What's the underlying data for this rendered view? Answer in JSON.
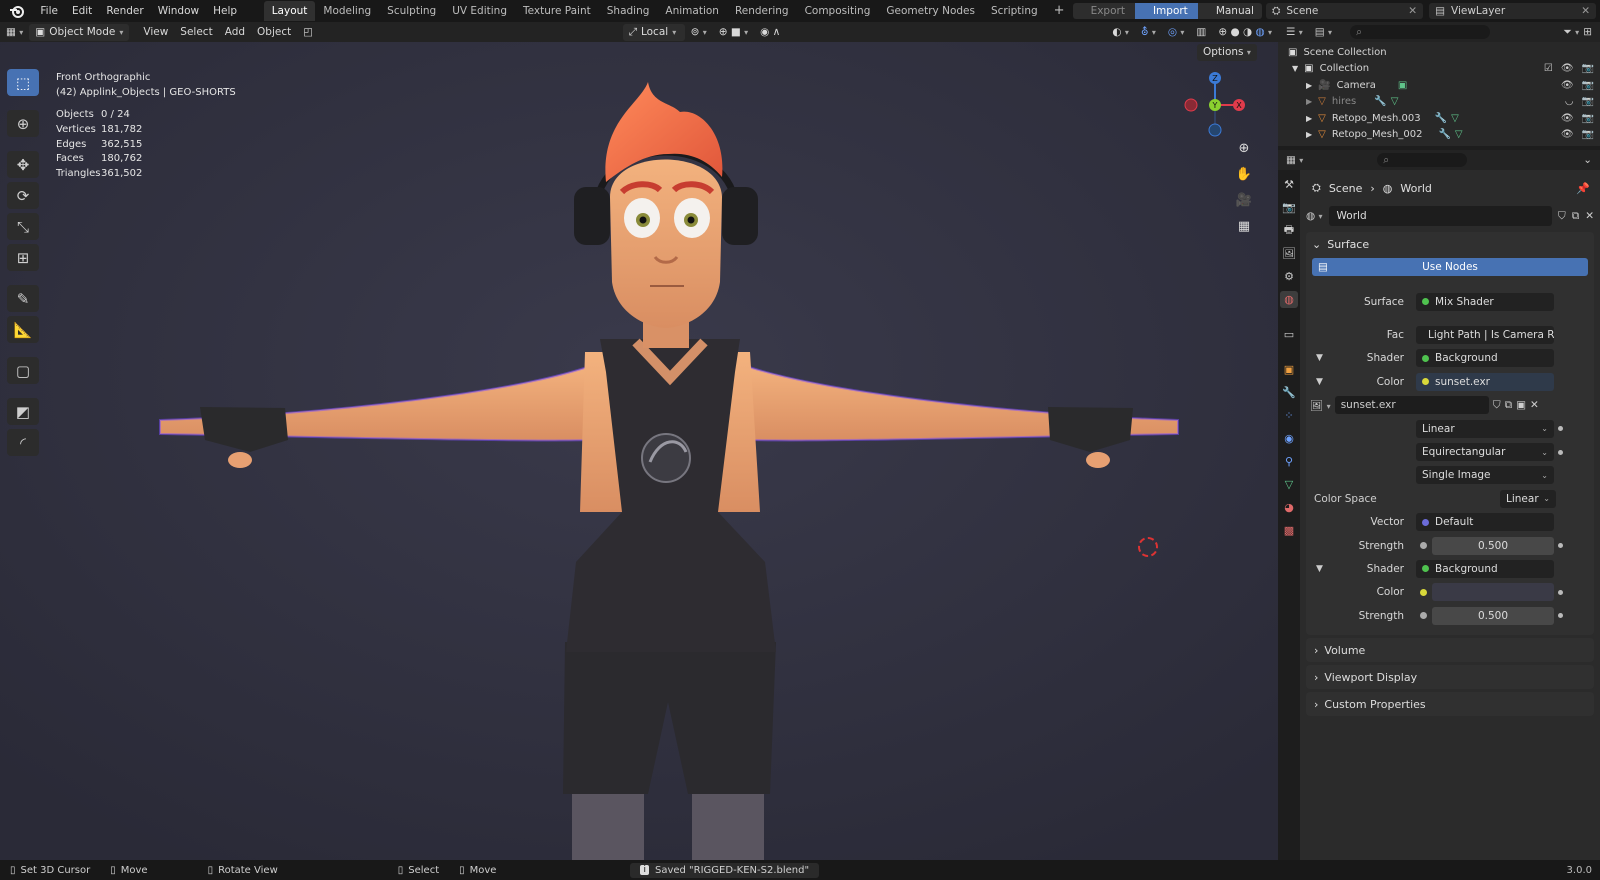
{
  "menu": {
    "items": [
      "File",
      "Edit",
      "Render",
      "Window",
      "Help"
    ]
  },
  "workspaces": {
    "tabs": [
      "Layout",
      "Modeling",
      "Sculpting",
      "UV Editing",
      "Texture Paint",
      "Shading",
      "Animation",
      "Rendering",
      "Compositing",
      "Geometry Nodes",
      "Scripting"
    ],
    "active": "Layout"
  },
  "topright": {
    "export": "Export",
    "import": "Import",
    "manual": "Manual",
    "scene": "Scene",
    "viewlayer": "ViewLayer"
  },
  "header": {
    "mode": "Object Mode",
    "view": "View",
    "select": "Select",
    "add": "Add",
    "object": "Object",
    "transform_orientation": "Local",
    "options": "Options"
  },
  "viewport": {
    "view_name": "Front Orthographic",
    "collection_line": "(42) Applink_Objects | GEO-SHORTS",
    "stats": [
      {
        "label": "Objects",
        "value": "0 / 24"
      },
      {
        "label": "Vertices",
        "value": "181,782"
      },
      {
        "label": "Edges",
        "value": "362,515"
      },
      {
        "label": "Faces",
        "value": "180,762"
      },
      {
        "label": "Triangles",
        "value": "361,502"
      }
    ],
    "gizmo": {
      "z": "Z",
      "y": "Y",
      "x": "X"
    }
  },
  "outliner": {
    "root": "Scene Collection",
    "collection": "Collection",
    "items": [
      {
        "name": "Camera"
      },
      {
        "name": "hires"
      },
      {
        "name": "Retopo_Mesh.003"
      },
      {
        "name": "Retopo_Mesh_002"
      }
    ]
  },
  "properties": {
    "breadcrumb": {
      "scene": "Scene",
      "world": "World"
    },
    "world_name": "World",
    "surface_panel": "Surface",
    "use_nodes": "Use Nodes",
    "rows": {
      "surface": {
        "label": "Surface",
        "value": "Mix Shader"
      },
      "fac": {
        "label": "Fac",
        "value": "Light Path | Is Camera Ray"
      },
      "shader1": {
        "label": "Shader",
        "value": "Background"
      },
      "color1": {
        "label": "Color",
        "value": "sunset.exr"
      },
      "image": "sunset.exr",
      "interp": "Linear",
      "projection": "Equirectangular",
      "source": "Single Image",
      "colorspace": {
        "label": "Color Space",
        "value": "Linear"
      },
      "vector": {
        "label": "Vector",
        "value": "Default"
      },
      "strength1": {
        "label": "Strength",
        "value": "0.500"
      },
      "shader2": {
        "label": "Shader",
        "value": "Background"
      },
      "color2": {
        "label": "Color"
      },
      "strength2": {
        "label": "Strength",
        "value": "0.500"
      }
    },
    "collapsed": [
      "Volume",
      "Viewport Display",
      "Custom Properties"
    ]
  },
  "statusbar": {
    "set_cursor": "Set 3D Cursor",
    "move1": "Move",
    "rotate": "Rotate View",
    "select": "Select",
    "move2": "Move",
    "message": "Saved \"RIGGED-KEN-S2.blend\"",
    "version": "3.0.0"
  },
  "colors": {
    "accent": "#4772b3",
    "viewport_bg": "#2f2f3e",
    "green_socket": "#4fc24f",
    "yellow_socket": "#d8d83a",
    "purple_socket": "#6b6bd8"
  }
}
